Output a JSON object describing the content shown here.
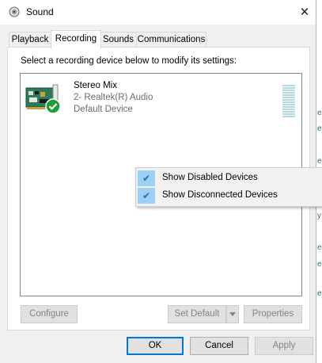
{
  "window": {
    "title": "Sound",
    "close_glyph": "✕"
  },
  "tabs": [
    {
      "label": "Playback",
      "active": false
    },
    {
      "label": "Recording",
      "active": true
    },
    {
      "label": "Sounds",
      "active": false
    },
    {
      "label": "Communications",
      "active": false
    }
  ],
  "panel": {
    "instruction": "Select a recording device below to modify its settings:"
  },
  "devices": [
    {
      "name": "Stereo Mix",
      "description": "2- Realtek(R) Audio",
      "status": "Default Device",
      "icon": "sound-card-icon",
      "badge": "default-checkmark-icon",
      "level": 0
    }
  ],
  "context_menu": {
    "items": [
      {
        "label": "Show Disabled Devices",
        "checked": true
      },
      {
        "label": "Show Disconnected Devices",
        "checked": true
      }
    ]
  },
  "buttons": {
    "configure": "Configure",
    "set_default": "Set Default",
    "properties": "Properties",
    "ok": "OK",
    "cancel": "Cancel",
    "apply": "Apply"
  },
  "colors": {
    "accent": "#0078d7",
    "menu_highlight": "#9ecff5",
    "default_badge": "#1e9e3a",
    "level_meter": "#b5d9e4"
  }
}
